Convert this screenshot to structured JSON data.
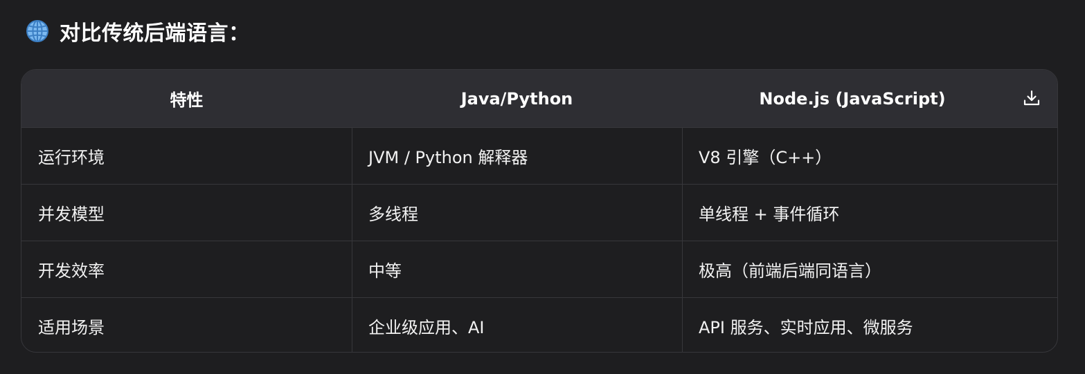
{
  "heading": {
    "icon": "globe-icon",
    "text": "对比传统后端语言："
  },
  "table": {
    "headers": [
      "特性",
      "Java/Python",
      "Node.js (JavaScript)"
    ],
    "download_icon": "download-icon",
    "rows": [
      [
        "运行环境",
        "JVM / Python 解释器",
        "V8 引擎（C++）"
      ],
      [
        "并发模型",
        "多线程",
        "单线程 + 事件循环"
      ],
      [
        "开发效率",
        "中等",
        "极高（前端后端同语言）"
      ],
      [
        "适用场景",
        "企业级应用、AI",
        "API 服务、实时应用、微服务"
      ]
    ]
  },
  "colors": {
    "background": "#1e1e20",
    "header_bg": "#2e2e33",
    "border": "#37373b",
    "text": "#ffffff"
  }
}
